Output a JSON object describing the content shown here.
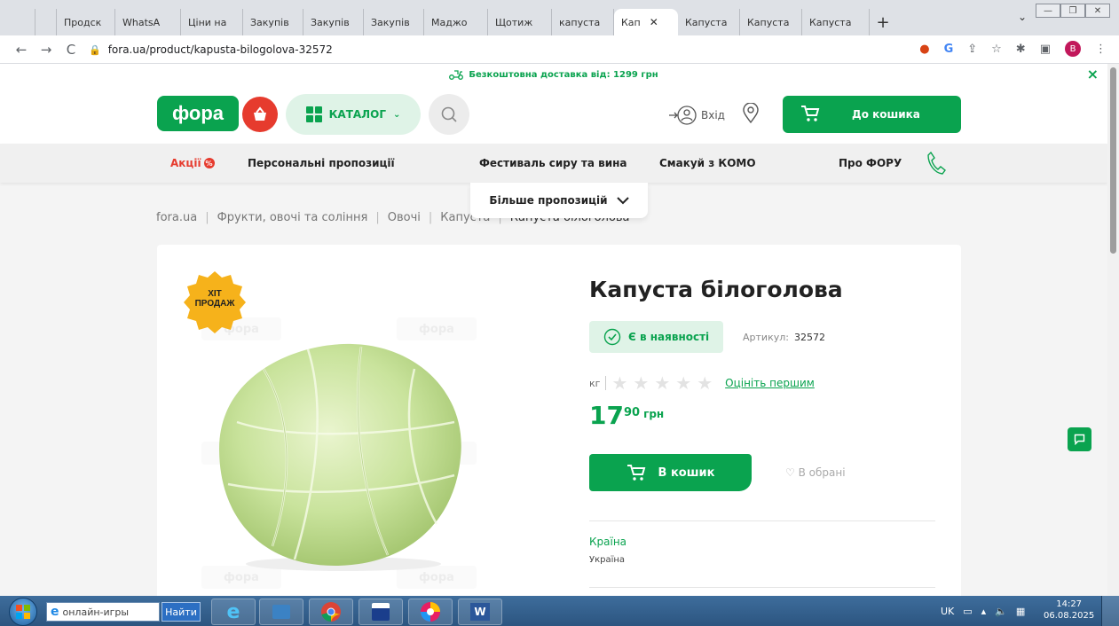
{
  "browser": {
    "tabs": [
      {
        "label": "",
        "fav_color": "#fff",
        "fav_text": ")",
        "fav_fg": "#e84c3d"
      },
      {
        "label": "",
        "fav_color": "#fff",
        "fav_text": "M",
        "fav_fg": "#d93025"
      },
      {
        "label": "Продск",
        "fav_color": "#0f9d58",
        "fav_text": "+",
        "fav_fg": "#fff"
      },
      {
        "label": "WhatsA",
        "fav_color": "#25d366",
        "fav_text": "✆",
        "fav_fg": "#fff"
      },
      {
        "label": "Ціни на",
        "fav_color": "#fff",
        "fav_text": "M",
        "fav_fg": "#d32f2f"
      },
      {
        "label": "Закупів",
        "fav_color": "#1e88e5",
        "fav_text": "●",
        "fav_fg": "#ffd600"
      },
      {
        "label": "Закупів",
        "fav_color": "#1e88e5",
        "fav_text": "●",
        "fav_fg": "#ffd600"
      },
      {
        "label": "Закупів",
        "fav_color": "#1e88e5",
        "fav_text": "●",
        "fav_fg": "#ffd600"
      },
      {
        "label": "Маджо",
        "fav_color": "#f9a825",
        "fav_text": "♔",
        "fav_fg": "#fff"
      },
      {
        "label": "Щотиж",
        "fav_color": "#e53935",
        "fav_text": "A",
        "fav_fg": "#fff"
      },
      {
        "label": "капуста",
        "fav_color": "#fff",
        "fav_text": "G",
        "fav_fg": "#4285f4"
      },
      {
        "label": "Кап",
        "fav_color": "#0aa34f",
        "fav_text": "ф",
        "fav_fg": "#fff",
        "active": true
      },
      {
        "label": "Капуста",
        "fav_color": "#7cb342",
        "fav_text": "●",
        "fav_fg": "#fff"
      },
      {
        "label": "Капуста",
        "fav_color": "#fff",
        "fav_text": "♣",
        "fav_fg": "#d32f2f"
      },
      {
        "label": "Капуста",
        "fav_color": "#ff9800",
        "fav_text": "~",
        "fav_fg": "#fff"
      }
    ],
    "url": "fora.ua/product/kapusta-bilogolova-32572",
    "profile_initial": "B"
  },
  "site": {
    "promo": "Безкоштовна доставка від: 1299 грн",
    "logo": "фора",
    "catalog_label": "КАТАЛОГ",
    "login_label": "Вхід",
    "cart_label": "До кошика",
    "menu": {
      "sale": "Акції",
      "personal": "Персональні пропозиції",
      "festival": "Фестиваль сиру та вина",
      "komo": "Смакуй з КОМО",
      "about": "Про ФОРУ",
      "more": "Більше пропозицій"
    },
    "breadcrumbs": [
      "fora.ua",
      "Фрукти, овочі та соління",
      "Овочі",
      "Капуста",
      "Капуста білоголова"
    ],
    "watermark": "фора"
  },
  "product": {
    "badge_line1": "ХІТ",
    "badge_line2": "ПРОДАЖ",
    "title": "Капуста білоголова",
    "stock": "Є в наявності",
    "sku_label": "Артикул:",
    "sku": "32572",
    "unit": "кг",
    "rating": 0,
    "rate_link": "Оцініть першим",
    "price_int": "17",
    "price_dec": "90",
    "currency": "грн",
    "add_to_cart": "В кошик",
    "favorite": "В обрані",
    "country_label": "Країна",
    "country_value": "Україна"
  },
  "taskbar": {
    "search_text": "онлайн-игры",
    "find_label": "Найти",
    "lang": "UK",
    "time": "14:27",
    "date": "06.08.2025"
  },
  "colors": {
    "brand_green": "#0aa34f",
    "brand_red": "#e63b2e"
  }
}
